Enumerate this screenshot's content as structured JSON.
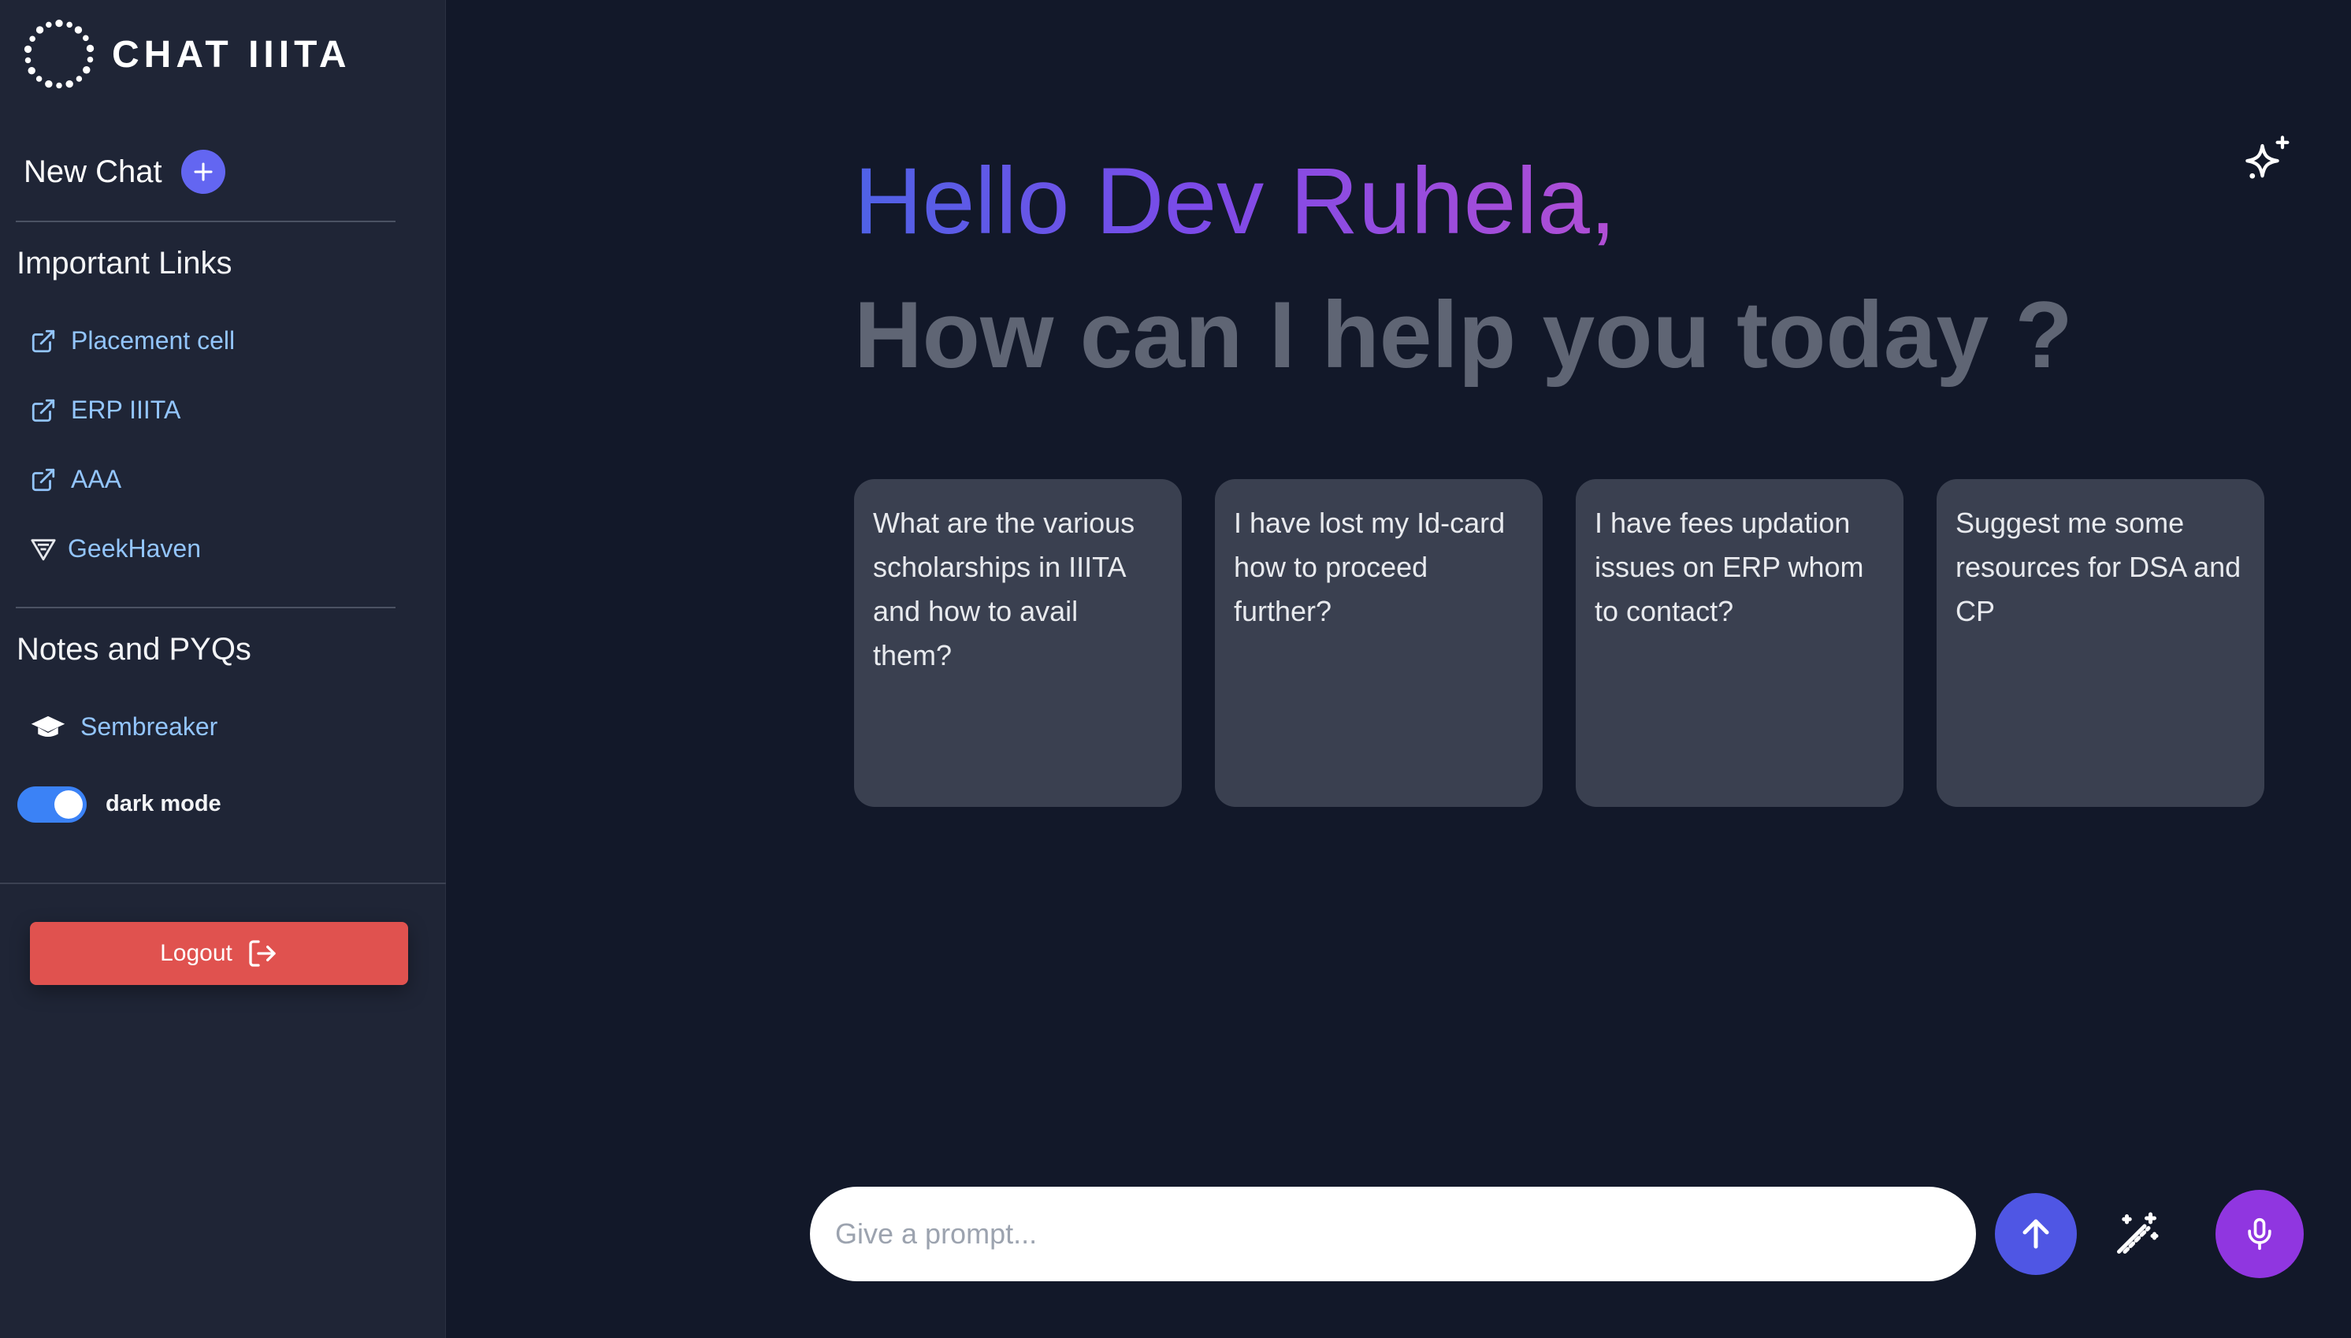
{
  "brand": {
    "name": "CHAT IIITA",
    "logo_icon": "dotted-ring-icon"
  },
  "sidebar": {
    "new_chat_label": "New Chat",
    "important_links_title": "Important Links",
    "links": [
      {
        "label": "Placement cell",
        "icon": "external-link-icon"
      },
      {
        "label": "ERP IIITA",
        "icon": "external-link-icon"
      },
      {
        "label": "AAA",
        "icon": "external-link-icon"
      },
      {
        "label": "GeekHaven",
        "icon": "geekhaven-icon"
      }
    ],
    "notes_title": "Notes and PYQs",
    "notes_links": [
      {
        "label": "Sembreaker",
        "icon": "graduation-cap-icon"
      }
    ],
    "dark_mode_label": "dark mode",
    "dark_mode_on": true,
    "logout_label": "Logout"
  },
  "main": {
    "greeting": "Hello Dev Ruhela,",
    "subgreeting": "How can I help you today ?",
    "suggestions": [
      "What are the various scholarships in IIITA and how to avail them?",
      "I have lost my Id-card how to proceed further?",
      "I have fees updation issues on ERP whom to contact?",
      "Suggest me some resources for DSA and CP"
    ]
  },
  "prompt": {
    "placeholder": "Give a prompt..."
  },
  "colors": {
    "background": "#121829",
    "sidebar": "#1f2536",
    "accent_indigo": "#6366f1",
    "logout_red": "#e0524f",
    "mic_purple": "#9036e0",
    "link_blue": "#93c5fd"
  }
}
